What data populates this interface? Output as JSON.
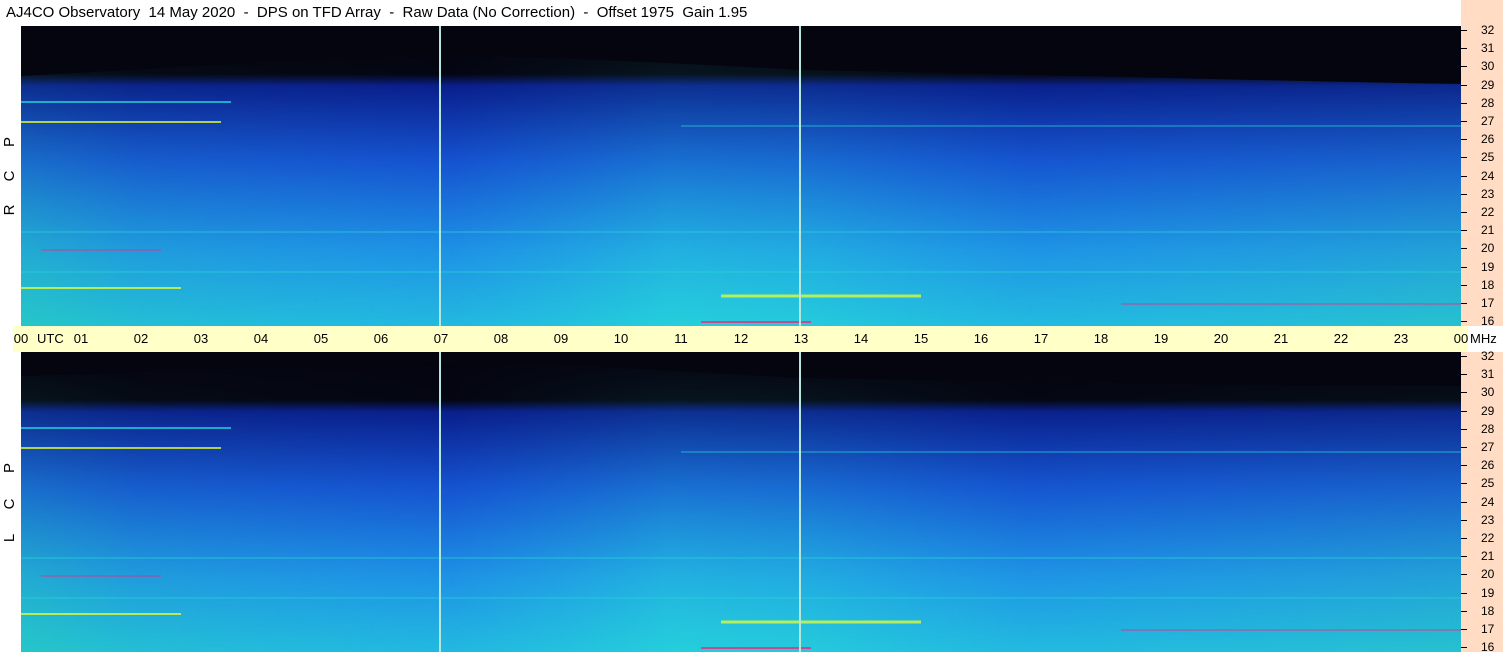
{
  "title": "AJ4CO Observatory  14 May 2020  -  DPS on TFD Array  -  Raw Data (No Correction)  -  Offset 1975  Gain 1.95",
  "panels": {
    "top": {
      "label_letters": [
        "P",
        "C",
        "R"
      ]
    },
    "bottom": {
      "label_letters": [
        "P",
        "C",
        "L"
      ]
    }
  },
  "time_axis": {
    "utc_label": "UTC",
    "unit_label": "MHz",
    "ticks": [
      "00",
      "01",
      "02",
      "03",
      "04",
      "05",
      "06",
      "07",
      "08",
      "09",
      "10",
      "11",
      "12",
      "13",
      "14",
      "15",
      "16",
      "17",
      "18",
      "19",
      "20",
      "21",
      "22",
      "23",
      "00"
    ]
  },
  "freq_axis": {
    "ticks": [
      "32",
      "31",
      "30",
      "29",
      "28",
      "27",
      "26",
      "25",
      "24",
      "23",
      "22",
      "21",
      "20",
      "19",
      "18",
      "17",
      "16"
    ]
  },
  "colors": {
    "background": "#ffffff",
    "time_strip": "#ffffc8",
    "freq_axis": "#ffdcc3",
    "no_data": "#000000",
    "low_power": "#0a1e8c",
    "mid_power": "#1e78e6",
    "high_power": "#28d2dc",
    "interference": "#e6ff32",
    "strong_interference": "#ff1e78"
  }
}
